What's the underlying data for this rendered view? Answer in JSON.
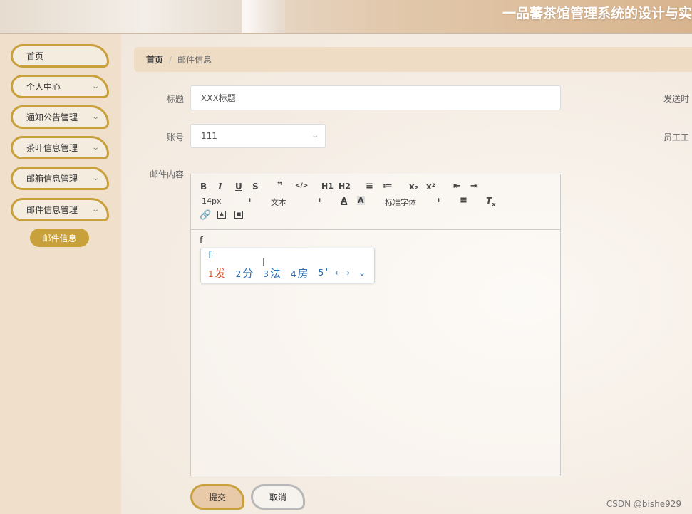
{
  "header": {
    "title": "一品蕃茶馆管理系统的设计与实"
  },
  "sidebar": {
    "items": [
      {
        "label": "首页",
        "has_arrow": false
      },
      {
        "label": "个人中心",
        "has_arrow": true
      },
      {
        "label": "通知公告管理",
        "has_arrow": true
      },
      {
        "label": "茶叶信息管理",
        "has_arrow": true
      },
      {
        "label": "邮箱信息管理",
        "has_arrow": true
      },
      {
        "label": "邮件信息管理",
        "has_arrow": true
      }
    ],
    "active_sub": "邮件信息",
    "accent_color": "#c9a13c"
  },
  "breadcrumb": {
    "home": "首页",
    "separator": "/",
    "current": "邮件信息"
  },
  "form": {
    "title_label": "标题",
    "title_value": "XXX标题",
    "send_time_label": "发送时",
    "account_label": "账号",
    "account_value": "111",
    "employee_label": "员工工",
    "content_label": "邮件内容"
  },
  "editor": {
    "toolbar_row1": [
      "B",
      "I",
      "U",
      "S",
      "❞",
      "</>",
      "H1",
      "H2",
      "≡",
      "≔",
      "x₂",
      "x²",
      "⇤",
      "⇥"
    ],
    "font_size": "14px",
    "text_style": "文本",
    "font_family": "标准字体",
    "typed_text": "f"
  },
  "ime": {
    "typed": "f",
    "candidates": [
      {
        "n": "1",
        "text": "发"
      },
      {
        "n": "2",
        "text": "分"
      },
      {
        "n": "3",
        "text": "法"
      },
      {
        "n": "4",
        "text": "房"
      },
      {
        "n": "5",
        "text": "'"
      }
    ],
    "nav": "‹ › ⌄"
  },
  "buttons": {
    "submit": "提交",
    "cancel": "取消"
  },
  "watermark": "CSDN @bishe929"
}
